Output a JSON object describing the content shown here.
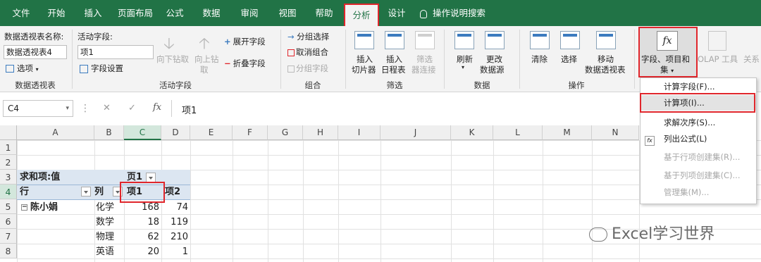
{
  "tabs": [
    "文件",
    "开始",
    "插入",
    "页面布局",
    "公式",
    "数据",
    "审阅",
    "视图",
    "帮助",
    "分析",
    "设计"
  ],
  "tell_me": "操作说明搜索",
  "ribbon": {
    "pt_name_label": "数据透视表名称:",
    "pt_name_value": "数据透视表4",
    "options_label": "选项",
    "group_pivottable": "数据透视表",
    "active_field_label": "活动字段:",
    "active_field_value": "项1",
    "field_settings": "字段设置",
    "drill_down": "向下钻取",
    "drill_up_1": "向上钻",
    "drill_up_2": "取",
    "expand_field": "展开字段",
    "collapse_field": "折叠字段",
    "group_active_field": "活动字段",
    "group_selection": "分组选择",
    "ungroup": "取消组合",
    "group_field": "分组字段",
    "group_group": "组合",
    "insert_slicer_1": "插入",
    "insert_slicer_2": "切片器",
    "insert_timeline_1": "插入",
    "insert_timeline_2": "日程表",
    "filter_conn_1": "筛选",
    "filter_conn_2": "器连接",
    "group_filter": "筛选",
    "refresh": "刷新",
    "change_source_1": "更改",
    "change_source_2": "数据源",
    "group_data": "数据",
    "clear": "清除",
    "select": "选择",
    "move_1": "移动",
    "move_2": "数据透视表",
    "group_actions": "操作",
    "fields_items_1": "字段、项目和",
    "fields_items_2": "集",
    "olap_1": "OLAP 工具",
    "relations": "关系",
    "fx_glyph": "fx"
  },
  "formula_bar": {
    "name_box": "C4",
    "cancel": "✕",
    "enter": "✓",
    "fx": "fx",
    "formula": "项1"
  },
  "columns": [
    "A",
    "B",
    "C",
    "D",
    "E",
    "F",
    "G",
    "H",
    "I",
    "J",
    "K",
    "L",
    "M",
    "N"
  ],
  "rows": [
    "1",
    "2",
    "3",
    "4",
    "5",
    "6",
    "7",
    "8"
  ],
  "pivot": {
    "sum_label": "求和项:值",
    "row_label": "行",
    "col_label": "列",
    "page_field": "页1",
    "item1": "项1",
    "item2": "项2",
    "row_item": "陈小娟",
    "subjects": [
      "化学",
      "数学",
      "物理",
      "英语"
    ],
    "item1_values": [
      "168",
      "18",
      "62",
      "20"
    ],
    "item2_values": [
      "74",
      "119",
      "210",
      "1"
    ]
  },
  "menu": {
    "items": [
      "计算字段(F)...",
      "计算项(I)...",
      "求解次序(S)...",
      "列出公式(L)",
      "基于行项创建集(R)...",
      "基于列项创建集(C)...",
      "管理集(M)..."
    ],
    "enabled": [
      true,
      true,
      true,
      true,
      false,
      false,
      false
    ]
  },
  "watermark": "Excel学习世界",
  "colors": {
    "excel_green": "#217346",
    "highlight_red": "#e0262c",
    "pivot_header_bg": "#dce6f1"
  }
}
